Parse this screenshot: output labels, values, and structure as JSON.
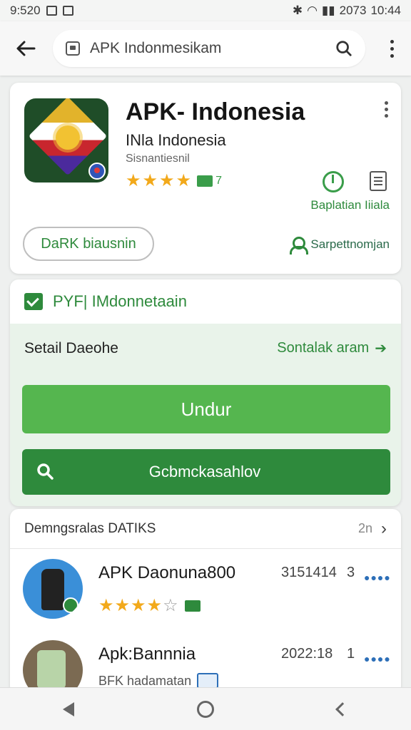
{
  "status_bar": {
    "time_left": "9:520",
    "battery": "2073",
    "time_right": "10:44"
  },
  "app_bar": {
    "search_text": "APK Indonmesikam"
  },
  "app_card": {
    "title": "APK- Indonesia",
    "subtitle": "INla Indonesia",
    "developer": "Sisnantiesnil",
    "rating_stars": 4,
    "rating_count": "7",
    "action_label": "Baplatian Iiiala",
    "outline_button": "DaRK biausnin",
    "share_label": "Sarpettnomjan"
  },
  "install_card": {
    "banner": "PYF| IMdonnetaain",
    "detail_title": "Setail Daeohe",
    "detail_link": "Sontalak aram",
    "primary_button": "Undur",
    "secondary_button": "Gcbmckasahlov"
  },
  "list_card": {
    "title": "Demngsralas DATIKS",
    "count": "2n",
    "items": [
      {
        "title": "APK Daonuna800",
        "meta": "3151414",
        "rank": "3",
        "stars": 3.5
      },
      {
        "title": "Apk:Bannnia",
        "meta": "2022:18",
        "rank": "1",
        "sub": "BFK hadamatan"
      }
    ]
  },
  "colors": {
    "accent": "#2e8a3c",
    "primary_button": "#55b64f",
    "star": "#f2a91b"
  }
}
